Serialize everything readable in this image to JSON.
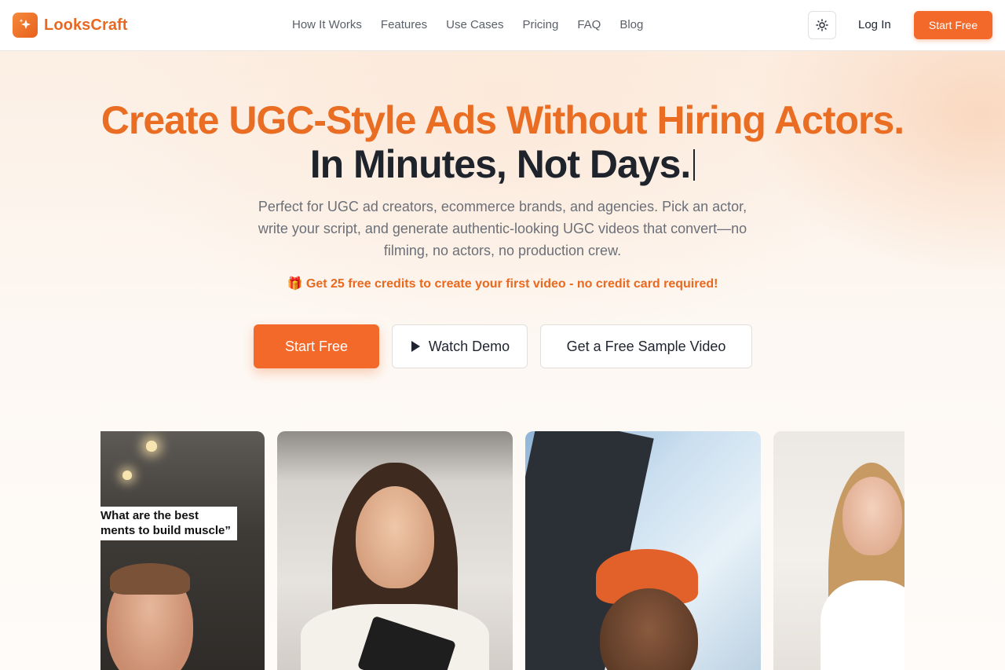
{
  "brand": {
    "name": "LooksCraft"
  },
  "nav": {
    "items": [
      {
        "label": "How It Works"
      },
      {
        "label": "Features"
      },
      {
        "label": "Use Cases"
      },
      {
        "label": "Pricing"
      },
      {
        "label": "FAQ"
      },
      {
        "label": "Blog"
      }
    ]
  },
  "header": {
    "theme_toggle_icon": "sun-icon",
    "login_label": "Log In",
    "start_label": "Start Free"
  },
  "hero": {
    "title_line1": "Create UGC-Style Ads Without Hiring Actors.",
    "title_line2": "In Minutes, Not Days.",
    "subtitle": "Perfect for UGC ad creators, ecommerce brands, and agencies. Pick an actor, write your script, and generate authentic-looking UGC videos that convert—no filming, no actors, no production crew.",
    "promo_icon": "🎁",
    "promo": "Get 25 free credits to create your first video - no credit card required!",
    "cta_primary": "Start Free",
    "cta_demo": "Watch Demo",
    "cta_sample": "Get a Free Sample Video"
  },
  "videos": {
    "cards": [
      {
        "caption_line1": "What are the best",
        "caption_line2": "ments to build muscle”"
      },
      {
        "caption_line1": "",
        "caption_line2": ""
      },
      {
        "caption_line1": "",
        "caption_line2": ""
      },
      {
        "caption_line1": "",
        "caption_line2": ""
      }
    ]
  },
  "colors": {
    "accent": "#f2692a",
    "brand_text": "#e8691f",
    "heading_dark": "#1f232b"
  }
}
